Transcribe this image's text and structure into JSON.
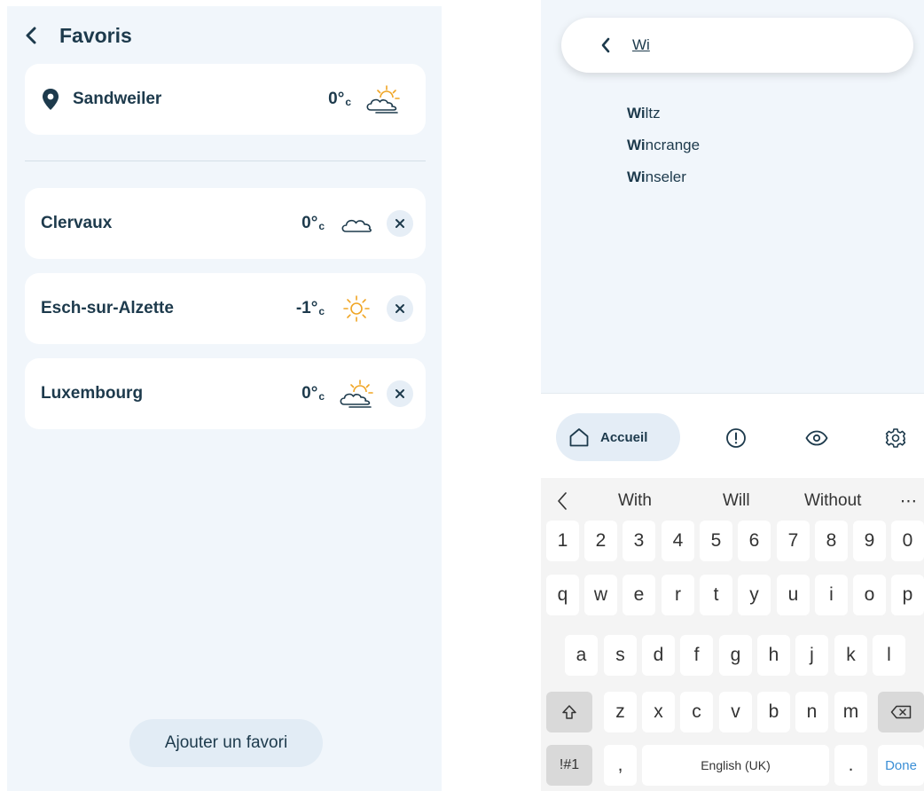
{
  "favorites_screen": {
    "title": "Favoris",
    "current_location": {
      "name": "Sandweiler",
      "temp": "0°",
      "unit": "c",
      "icon": "sun-cloud-icon"
    },
    "favorites": [
      {
        "name": "Clervaux",
        "temp": "0°",
        "unit": "c",
        "icon": "cloud-icon"
      },
      {
        "name": "Esch-sur-Alzette",
        "temp": "-1°",
        "unit": "c",
        "icon": "sun-icon"
      },
      {
        "name": "Luxembourg",
        "temp": "0°",
        "unit": "c",
        "icon": "sun-cloud-icon"
      }
    ],
    "add_button_label": "Ajouter un favori"
  },
  "search_screen": {
    "query": "Wi",
    "suggestions": [
      {
        "match": "Wi",
        "rest": "ltz"
      },
      {
        "match": "Wi",
        "rest": "ncrange"
      },
      {
        "match": "Wi",
        "rest": "nseler"
      }
    ],
    "nav": {
      "home_label": "Accueil"
    }
  },
  "keyboard": {
    "suggestions": [
      "With",
      "Will",
      "Without"
    ],
    "number_row": [
      "1",
      "2",
      "3",
      "4",
      "5",
      "6",
      "7",
      "8",
      "9",
      "0"
    ],
    "row1": [
      "q",
      "w",
      "e",
      "r",
      "t",
      "y",
      "u",
      "i",
      "o",
      "p"
    ],
    "row2": [
      "a",
      "s",
      "d",
      "f",
      "g",
      "h",
      "j",
      "k",
      "l"
    ],
    "row3": [
      "z",
      "x",
      "c",
      "v",
      "b",
      "n",
      "m"
    ],
    "symbols_label": "!#1",
    "comma_label": ",",
    "space_label": "English (UK)",
    "period_label": ".",
    "done_label": "Done"
  },
  "colors": {
    "text_primary": "#1d3a4c",
    "background": "#f1f6fb",
    "sun": "#f0a524",
    "done_blue": "#3b8fd6"
  }
}
